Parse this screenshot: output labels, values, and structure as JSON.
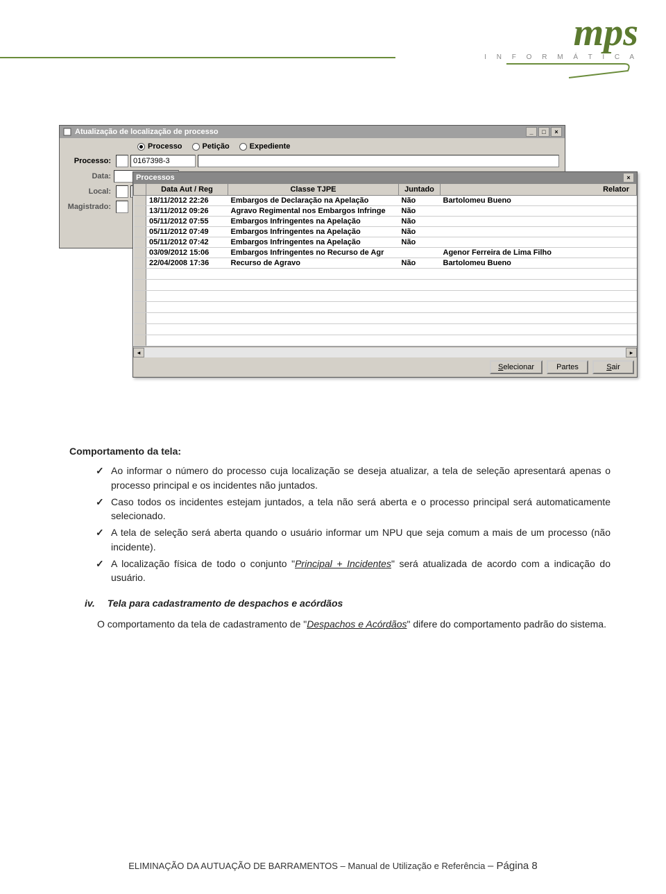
{
  "logo": {
    "script": "mps",
    "sub": "I N F O R M Á T I C A"
  },
  "app": {
    "title": "Atualização de localização de processo",
    "radios": [
      {
        "label": "Processo",
        "selected": true
      },
      {
        "label": "Petição",
        "selected": false
      },
      {
        "label": "Expediente",
        "selected": false
      }
    ],
    "fields": {
      "processo_label": "Processo:",
      "processo_value": "0167398-3",
      "data_label": "Data:",
      "local_label": "Local:",
      "magistrado_label": "Magistrado:"
    }
  },
  "popup": {
    "title": "Processos",
    "headers": [
      "Data Aut / Reg",
      "Classe TJPE",
      "Juntado",
      "Relator"
    ],
    "rows": [
      {
        "data": "18/11/2012 22:26",
        "classe": "Embargos de Declaração na Apelação",
        "juntado": "Não",
        "relator": "Bartolomeu Bueno"
      },
      {
        "data": "13/11/2012 09:26",
        "classe": "Agravo Regimental nos Embargos Infringe",
        "juntado": "Não",
        "relator": ""
      },
      {
        "data": "05/11/2012 07:55",
        "classe": "Embargos Infringentes na Apelação",
        "juntado": "Não",
        "relator": ""
      },
      {
        "data": "05/11/2012 07:49",
        "classe": "Embargos Infringentes na Apelação",
        "juntado": "Não",
        "relator": ""
      },
      {
        "data": "05/11/2012 07:42",
        "classe": "Embargos Infringentes na Apelação",
        "juntado": "Não",
        "relator": ""
      },
      {
        "data": "03/09/2012 15:06",
        "classe": "Embargos Infringentes no Recurso de Agr",
        "juntado": "",
        "relator": "Agenor Ferreira de Lima Filho"
      },
      {
        "data": "22/04/2008 17:36",
        "classe": "Recurso de Agravo",
        "juntado": "Não",
        "relator": "Bartolomeu Bueno"
      }
    ],
    "buttons": {
      "selecionar": "Selecionar",
      "partes": "Partes",
      "sair": "Sair"
    }
  },
  "body": {
    "heading": "Comportamento da tela:",
    "b1": "Ao informar o número do processo cuja localização se deseja atualizar, a tela de seleção apresentará apenas o processo principal e os incidentes não juntados.",
    "b2": "Caso todos os incidentes estejam juntados, a tela não será aberta e o processo principal será automaticamente selecionado.",
    "b3": "A tela de seleção será aberta quando o usuário informar um NPU que seja comum a mais de um processo (não incidente).",
    "b4a": "A localização física de todo o conjunto \"",
    "b4u": "Principal + Incidentes",
    "b4b": "\" será atualizada de acordo com a indicação do usuário.",
    "iv_num": "iv.",
    "iv_title": "Tela para cadastramento de despachos e acórdãos",
    "p1a": "O comportamento da tela de cadastramento de \"",
    "p1u": "Despachos e Acórdãos",
    "p1b": "\" difere do comportamento padrão do sistema."
  },
  "footer": {
    "text": "ELIMINAÇÃO DA AUTUAÇÃO DE BARRAMENTOS – Manual de Utilização e Referência",
    "sep": " – ",
    "page": "Página 8"
  }
}
